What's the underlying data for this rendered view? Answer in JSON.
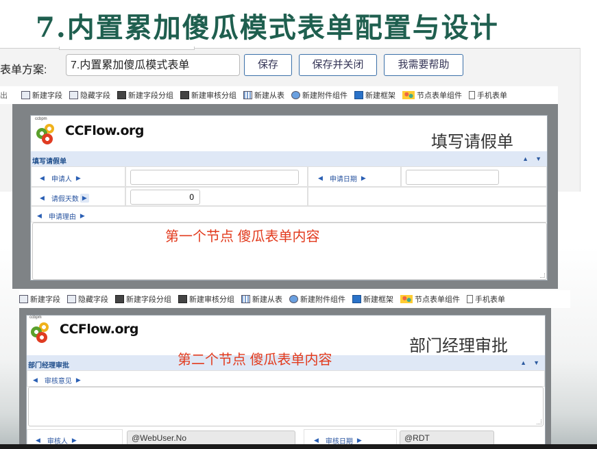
{
  "slide": {
    "title": "7.内置累加傻瓜模式表单配置与设计"
  },
  "scheme": {
    "label": "表单方案:",
    "value": "7.内置累加傻瓜模式表单",
    "save_label": "保存",
    "save_close_label": "保存并关闭",
    "help_label": "我需要帮助"
  },
  "toolbar": {
    "lead_label": "出",
    "items": [
      "新建字段",
      "隐藏字段",
      "新建字段分组",
      "新建审核分组",
      "新建从表",
      "新建附件组件",
      "新建框架",
      "节点表单组件",
      "手机表单"
    ]
  },
  "form1": {
    "logo_small": "ccbpm",
    "logo_text": "CCFlow.org",
    "heading": "填写请假单",
    "group_label": "填写请假单",
    "fields": {
      "applicant": "申请人",
      "apply_date": "申请日期",
      "days": "请假天数",
      "days_value": "0",
      "reason": "申请理由"
    },
    "note": "第一个节点  傻瓜表单内容"
  },
  "form2": {
    "logo_small": "ccbpm",
    "logo_text": "CCFlow.org",
    "heading": "部门经理审批",
    "group_label": "部门经理审批",
    "note": "第二个节点 傻瓜表单内容",
    "fields": {
      "opinion": "审核意见",
      "reviewer": "审核人",
      "reviewer_value": "@WebUser.No",
      "review_date": "审核日期",
      "review_date_value": "@RDT"
    }
  },
  "colors": {
    "title": "#1f5f4f",
    "note": "#e23b1e",
    "band": "#dfe8f6",
    "link": "#2a55a0"
  }
}
